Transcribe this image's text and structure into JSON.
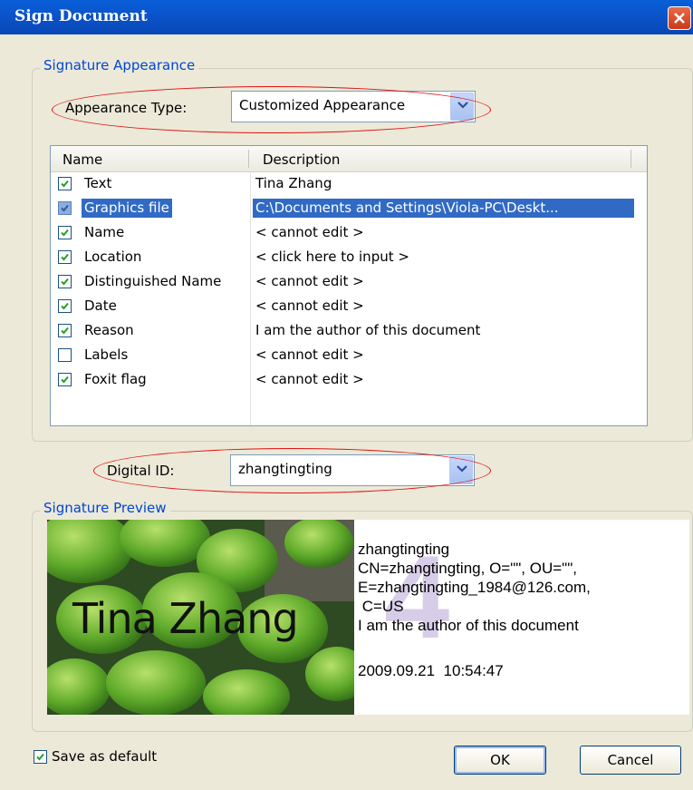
{
  "window": {
    "title": "Sign Document"
  },
  "appearance_group": {
    "legend": "Signature Appearance",
    "type_label": "Appearance Type:",
    "type_value": "Customized Appearance"
  },
  "table": {
    "headers": [
      "Name",
      "Description"
    ],
    "rows": [
      {
        "checked": true,
        "name": "Text",
        "description": "Tina Zhang"
      },
      {
        "checked": true,
        "name": "Graphics file",
        "description": "C:\\Documents and Settings\\Viola-PC\\Deskt...",
        "selected": true
      },
      {
        "checked": true,
        "name": "Name",
        "description": "< cannot edit >"
      },
      {
        "checked": true,
        "name": "Location",
        "description": "< click here to input >"
      },
      {
        "checked": true,
        "name": "Distinguished Name",
        "description": "< cannot edit >"
      },
      {
        "checked": true,
        "name": "Date",
        "description": "< cannot edit >"
      },
      {
        "checked": true,
        "name": "Reason",
        "description": "I am the author of this document"
      },
      {
        "checked": false,
        "name": "Labels",
        "description": "< cannot edit >"
      },
      {
        "checked": true,
        "name": "Foxit flag",
        "description": "< cannot edit >"
      }
    ]
  },
  "digital_id": {
    "label": "Digital ID:",
    "value": "zhangtingting"
  },
  "preview_group": {
    "legend": "Signature Preview",
    "image_text": "Tina Zhang",
    "watermark": "4",
    "lines": [
      "zhangtingting",
      "CN=zhangtingting, O=\"\", OU=\"\",",
      "E=zhangtingting_1984@126.com,",
      " C=US",
      "I am the author of this document",
      "",
      "2009.09.21  10:54:47"
    ]
  },
  "footer": {
    "save_default_label": "Save as default",
    "save_default_checked": true,
    "ok_label": "OK",
    "cancel_label": "Cancel"
  },
  "colors": {
    "titlebar": "#0a5fd8",
    "accent_text": "#0046d5",
    "selection": "#316ac5",
    "highlight_ellipse": "#e01010"
  }
}
